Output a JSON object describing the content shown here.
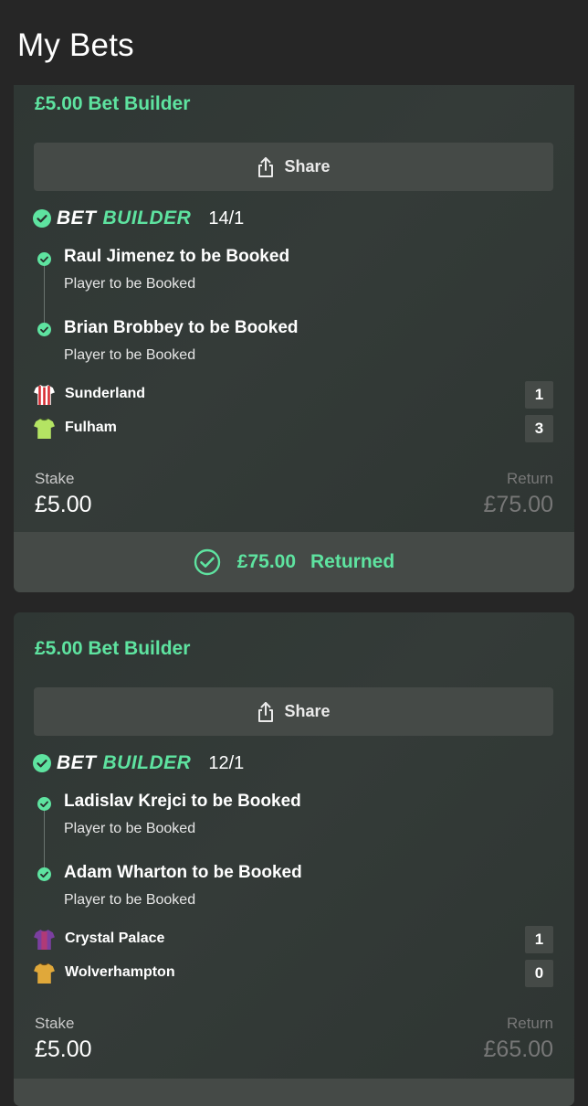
{
  "page": {
    "title": "My Bets"
  },
  "bets": [
    {
      "title": "£5.00 Bet Builder",
      "share_label": "Share",
      "badge_bet": "BET",
      "badge_builder": "BUILDER",
      "odds": "14/1",
      "legs": [
        {
          "title": "Raul Jimenez to be Booked",
          "market": "Player to be Booked"
        },
        {
          "title": "Brian Brobbey to be Booked",
          "market": "Player to be Booked"
        }
      ],
      "teams": [
        {
          "name": "Sunderland",
          "score": "1",
          "kit_icon": "striped-shirt-icon"
        },
        {
          "name": "Fulham",
          "score": "3",
          "kit_icon": "green-shirt-icon"
        }
      ],
      "stake_label": "Stake",
      "stake": "£5.00",
      "return_label": "Return",
      "return": "£75.00",
      "returned_amount": "£75.00",
      "returned_label": "Returned"
    },
    {
      "title": "£5.00 Bet Builder",
      "share_label": "Share",
      "badge_bet": "BET",
      "badge_builder": "BUILDER",
      "odds": "12/1",
      "legs": [
        {
          "title": "Ladislav Krejci to be Booked",
          "market": "Player to be Booked"
        },
        {
          "title": "Adam Wharton to be Booked",
          "market": "Player to be Booked"
        }
      ],
      "teams": [
        {
          "name": "Crystal Palace",
          "score": "1",
          "kit_icon": "purple-shirt-icon"
        },
        {
          "name": "Wolverhampton",
          "score": "0",
          "kit_icon": "gold-shirt-icon"
        }
      ],
      "stake_label": "Stake",
      "stake": "£5.00",
      "return_label": "Return",
      "return": "£65.00"
    }
  ],
  "colors": {
    "accent": "#5ee3a0",
    "card_bg": "#323a37",
    "button_bg": "#454a47",
    "page_bg": "#262626"
  }
}
